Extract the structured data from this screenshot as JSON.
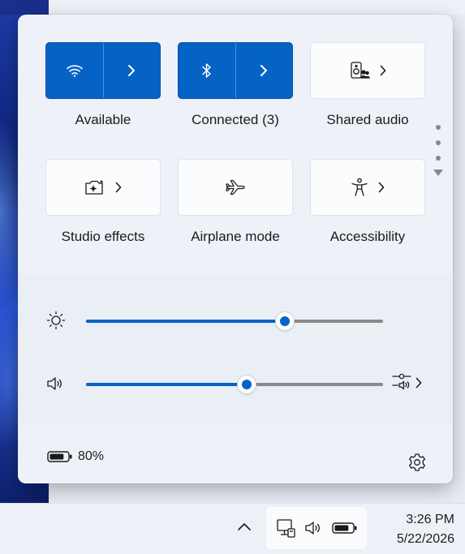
{
  "tiles": [
    {
      "label": "Available",
      "state": "on",
      "icon": "wifi-icon",
      "has_expand": true
    },
    {
      "label": "Connected (3)",
      "state": "on",
      "icon": "bluetooth-icon",
      "has_expand": true
    },
    {
      "label": "Shared audio",
      "state": "off",
      "icon": "speaker-people-icon",
      "has_expand": true
    },
    {
      "label": "Studio effects",
      "state": "off",
      "icon": "camera-sparkle-icon",
      "has_expand": true
    },
    {
      "label": "Airplane mode",
      "state": "off",
      "icon": "airplane-icon",
      "has_expand": false
    },
    {
      "label": "Accessibility",
      "state": "off",
      "icon": "accessibility-icon",
      "has_expand": true
    }
  ],
  "pager": {
    "pages": 3,
    "current": 1
  },
  "sliders": {
    "brightness": {
      "icon": "sun-icon",
      "value": 0.67
    },
    "volume": {
      "icon": "speaker-icon",
      "value": 0.54,
      "mixer_icon": "audio-mixer-icon"
    }
  },
  "footer": {
    "battery_text": "80%",
    "battery_level": 0.8,
    "settings_icon": "gear-icon"
  },
  "taskbar": {
    "time": "3:26 PM",
    "date": "5/22/2026",
    "tray_icons": [
      "network-icon",
      "speaker-icon",
      "battery-icon"
    ]
  },
  "colors": {
    "accent": "#0563c6",
    "panel": "#eef1f7",
    "track": "#8a8a8a"
  }
}
